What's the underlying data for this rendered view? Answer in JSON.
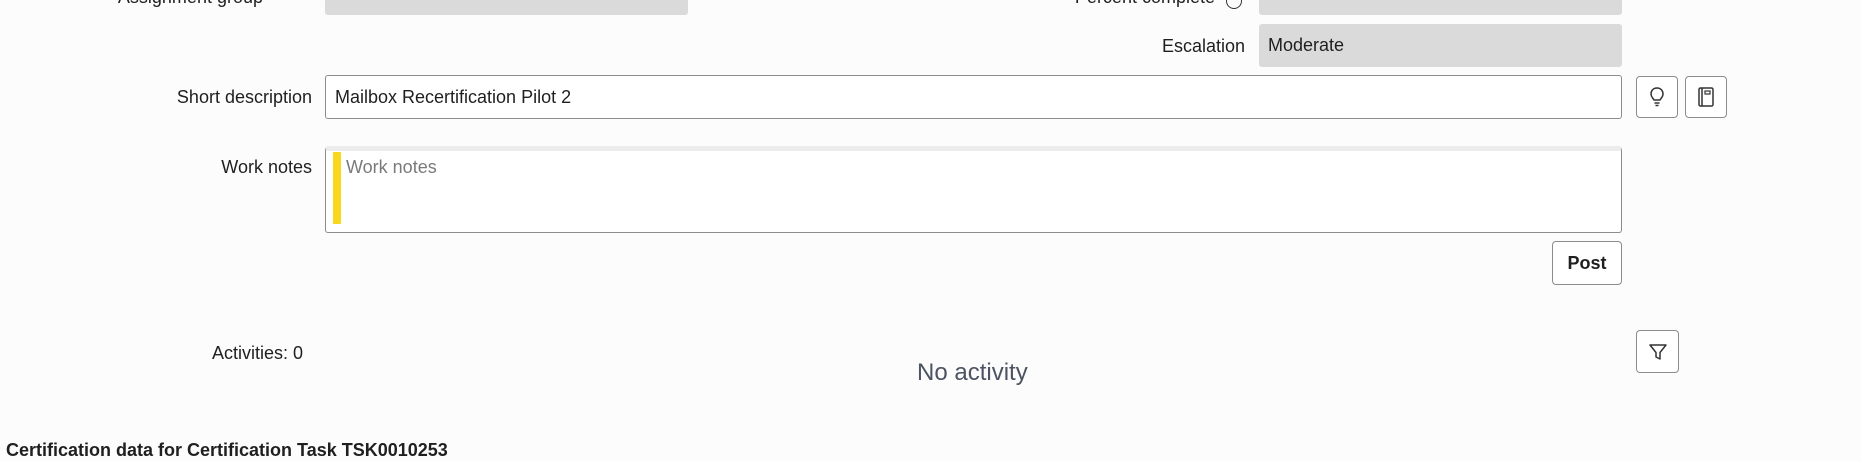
{
  "fields": {
    "assignment_group": {
      "label": "Assignment group",
      "value": ""
    },
    "percent_complete": {
      "label": "Percent complete",
      "value": ""
    },
    "escalation": {
      "label": "Escalation",
      "value": "Moderate"
    },
    "short_description": {
      "label": "Short description",
      "value": "Mailbox Recertification Pilot 2"
    },
    "work_notes": {
      "label": "Work notes",
      "placeholder": "Work notes"
    }
  },
  "buttons": {
    "post_label": "Post"
  },
  "icons": {
    "suggestion": "lightbulb-icon",
    "knowledge": "book-icon",
    "filter": "filter-icon",
    "info": "info-icon"
  },
  "activity": {
    "count_label": "Activities: 0",
    "empty_text": "No activity"
  },
  "section": {
    "title": "Certification data for Certification Task TSK0010253"
  },
  "colors": {
    "readonly_bg": "#dadada",
    "work_notes_accent": "#f9d71c",
    "border": "#8c8c8c"
  }
}
